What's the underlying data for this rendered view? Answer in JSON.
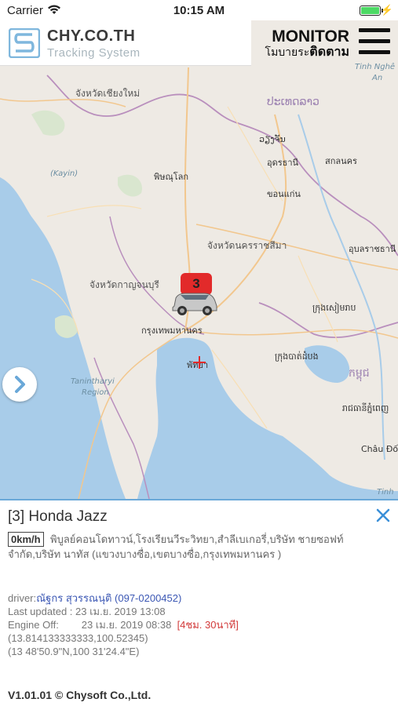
{
  "status_bar": {
    "carrier": "Carrier",
    "time": "10:15 AM"
  },
  "header": {
    "brand_name": "CHY.CO.TH",
    "brand_subtitle": "Tracking System",
    "monitor_title": "MONITOR",
    "monitor_sub_small": "โมบายระ",
    "monitor_sub_big": "ติดตาม"
  },
  "map": {
    "labels": {
      "l_chiangmai_prov": "จังหวัดเชียงใหม่",
      "l_laos": "ປະເທດລາວ",
      "l_udon": "อุดรธานี",
      "l_sakon": "สกลนคร",
      "l_khonkaen": "ขอนแก่น",
      "l_phitsanulok": "พิษณุโลก",
      "l_nakhon_rat": "จังหวัดนครราชสีมา",
      "l_kanchanaburi": "จังหวัดกาญจนบุรี",
      "l_bangkok": "กรุงเทพมหานคร",
      "l_pattaya": "พัทยา",
      "l_ubon": "อุบลราชธานี",
      "l_tinh_nghe": "Tinh Nghê",
      "l_an": "An",
      "l_kayin": "(Kayin)",
      "l_tanintharyi": "Tanintharyi",
      "l_region": "Region",
      "l_chau_doc": "Châu Đốc",
      "l_tinh": "Tinh",
      "l_vientiane": "ວຽງຈັນ",
      "l_cambodia": "កម្ពុជ",
      "l_phnompenh": "រាជធានីភ្នំពេញ",
      "l_siemreap": "ក្រុងសៀមរាប",
      "l_battambang": "ក្រុងបាត់ដំបង"
    },
    "vehicle_count": "3"
  },
  "detail": {
    "title": "[3] Honda Jazz",
    "speed": "0km/h",
    "address": "พิบูลย์คอนโดทาวน์,โรงเรียนวีระวิทยา,สำลีเบเกอรี่,บริษัท ชายซอฟท์ จำกัด,บริษัท นาทัส (แขวงบางซื่อ,เขตบางซื่อ,กรุงเทพมหานคร )",
    "driver_label": "driver:",
    "driver_value": "ณัฐกร สุวรรณนุติ (097-0200452)",
    "last_updated": "Last updated : 23 เม.ย. 2019 13:08",
    "engine_off_label": "Engine Off:",
    "engine_off_value": "23 เม.ย. 2019 08:38",
    "engine_off_duration": "[4ชม. 30นาที]",
    "coords_decimal": "(13.814133333333,100.52345)",
    "coords_dms": "(13 48'50.9\"N,100 31'24.4\"E)"
  },
  "footer": {
    "version": "V1.01.01 © Chysoft Co.,Ltd."
  },
  "colors": {
    "map_land": "#eeeae4",
    "map_water": "#a8cce9",
    "accent_blue": "#3b57b4",
    "alert_red": "#e22a2a",
    "panel_border": "#6aa8d8"
  }
}
